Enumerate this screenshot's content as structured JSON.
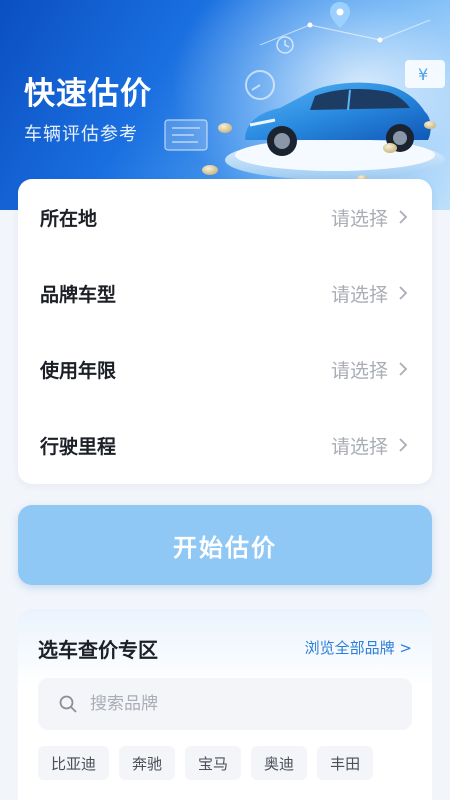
{
  "hero": {
    "title": "快速估价",
    "subtitle": "车辆评估参考"
  },
  "form": {
    "rows": [
      {
        "label": "所在地",
        "value": "请选择"
      },
      {
        "label": "品牌车型",
        "value": "请选择"
      },
      {
        "label": "使用年限",
        "value": "请选择"
      },
      {
        "label": "行驶里程",
        "value": "请选择"
      }
    ]
  },
  "start_button": {
    "label": "开始估价"
  },
  "brands": {
    "title": "选车查价专区",
    "browse_all": "浏览全部品牌 >",
    "search_placeholder": "搜索品牌",
    "chips": [
      "比亚迪",
      "奔驰",
      "宝马",
      "奥迪",
      "丰田"
    ]
  },
  "colors": {
    "hero_blue": "#1a6fe0",
    "button_blue": "#8fc7f5",
    "link_blue": "#2b7fd9",
    "car_blue": "#2a8be0"
  },
  "icons": {
    "chevron": "chevron-right-icon",
    "search": "search-icon",
    "car": "car-illustration",
    "coin": "coin-icon"
  }
}
